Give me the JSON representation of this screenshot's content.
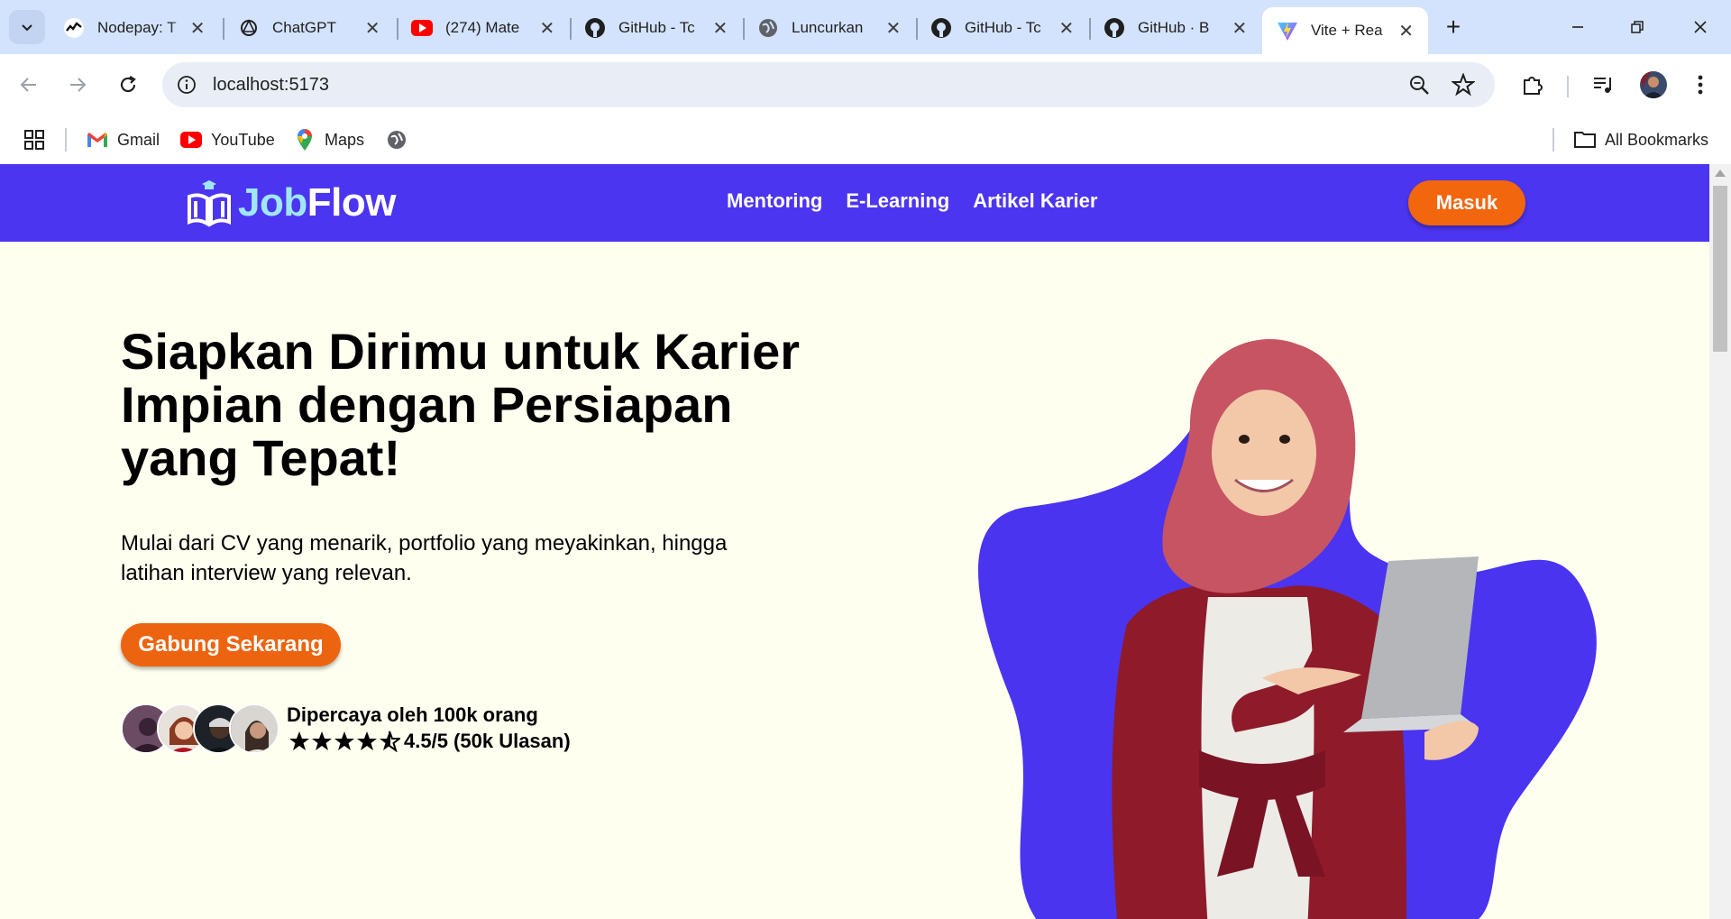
{
  "browser": {
    "tabs": [
      {
        "title": "Nodepay: T",
        "icon": "nodepay-icon",
        "active": false
      },
      {
        "title": "ChatGPT",
        "icon": "chatgpt-icon",
        "active": false
      },
      {
        "title": "(274) Mate",
        "icon": "youtube-icon",
        "active": false
      },
      {
        "title": "GitHub - Tc",
        "icon": "github-icon",
        "active": false
      },
      {
        "title": "Luncurkan",
        "icon": "globe-icon",
        "active": false
      },
      {
        "title": "GitHub - Tc",
        "icon": "github-icon",
        "active": false
      },
      {
        "title": "GitHub · B",
        "icon": "github-icon",
        "active": false
      },
      {
        "title": "Vite + Rea",
        "icon": "vite-icon",
        "active": true
      }
    ],
    "url": "localhost:5173",
    "bookmarks": [
      {
        "label": "Gmail",
        "icon": "gmail-icon"
      },
      {
        "label": "YouTube",
        "icon": "youtube-icon"
      },
      {
        "label": "Maps",
        "icon": "maps-icon"
      }
    ],
    "all_bookmarks_label": "All Bookmarks"
  },
  "site": {
    "brand": {
      "part1": "Job",
      "part2": "Flow"
    },
    "nav": [
      "Mentoring",
      "E-Learning",
      "Artikel Karier"
    ],
    "login_label": "Masuk",
    "colors": {
      "nav_bg": "#4c35f0",
      "accent": "#f2660d",
      "page_bg": "#fffff0",
      "blob": "#4a34f0"
    }
  },
  "hero": {
    "title": "Siapkan Dirimu untuk Karier Impian dengan Persiapan yang Tepat!",
    "subtitle": "Mulai dari CV yang menarik, portfolio yang meyakinkan, hingga latihan interview yang relevan.",
    "cta_label": "Gabung Sekarang",
    "trust_text": "Dipercaya oleh 100k orang",
    "rating_text": "4.5/5 (50k Ulasan)",
    "rating_value": 4.5,
    "rating_max": 5
  }
}
